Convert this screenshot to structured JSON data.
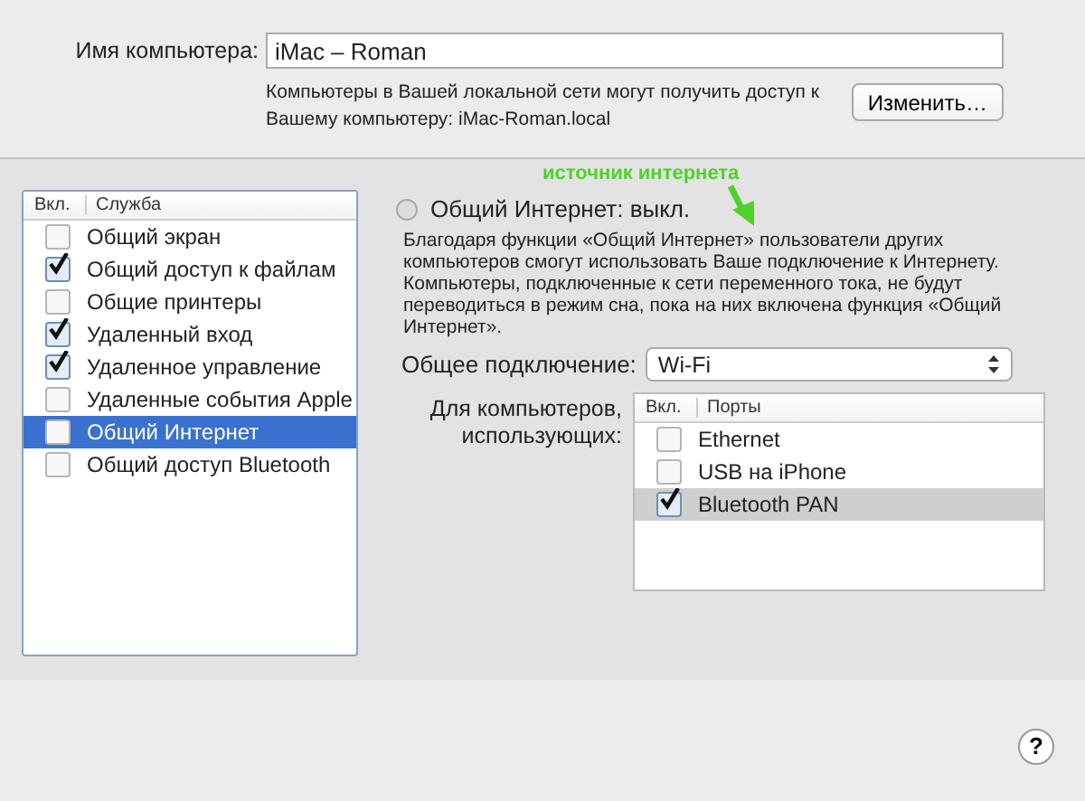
{
  "computer_name": {
    "label": "Имя компьютера:",
    "value": "iMac – Roman",
    "note": "Компьютеры в Вашей локальной сети могут получить доступ к Вашему компьютеру: iMac-Roman.local",
    "button": "Изменить…"
  },
  "services": {
    "columns": [
      "Вкл.",
      "Служба"
    ],
    "rows": [
      {
        "name": "Общий экран",
        "checked": false,
        "selected": false
      },
      {
        "name": "Общий доступ к файлам",
        "checked": true,
        "selected": false
      },
      {
        "name": "Общие принтеры",
        "checked": false,
        "selected": false
      },
      {
        "name": "Удаленный вход",
        "checked": true,
        "selected": false
      },
      {
        "name": "Удаленное управление",
        "checked": true,
        "selected": false
      },
      {
        "name": "Удаленные события Apple",
        "checked": false,
        "selected": false
      },
      {
        "name": "Общий Интернет",
        "checked": false,
        "selected": true
      },
      {
        "name": "Общий доступ Bluetooth",
        "checked": false,
        "selected": false
      }
    ]
  },
  "detail": {
    "status": "Общий Интернет: выкл.",
    "on": false,
    "description": "Благодаря функции «Общий Интернет» пользователи других компьютеров смогут использовать Ваше подключение к Интернету. Компьютеры, подключенные к сети переменного тока, не будут переводиться в режим сна, пока на них включена функция «Общий Интернет».",
    "connection_label": "Общее подключение:",
    "connection_value": "Wi-Fi",
    "ports_label": "Для компьютеров, использующих:",
    "ports": {
      "columns": [
        "Вкл.",
        "Порты"
      ],
      "rows": [
        {
          "name": "Ethernet",
          "checked": false,
          "selected": false
        },
        {
          "name": "USB на iPhone",
          "checked": false,
          "selected": false
        },
        {
          "name": "Bluetooth PAN",
          "checked": true,
          "selected": true
        }
      ]
    }
  },
  "annotation": {
    "text": "источник интернета"
  },
  "help_button": "?"
}
